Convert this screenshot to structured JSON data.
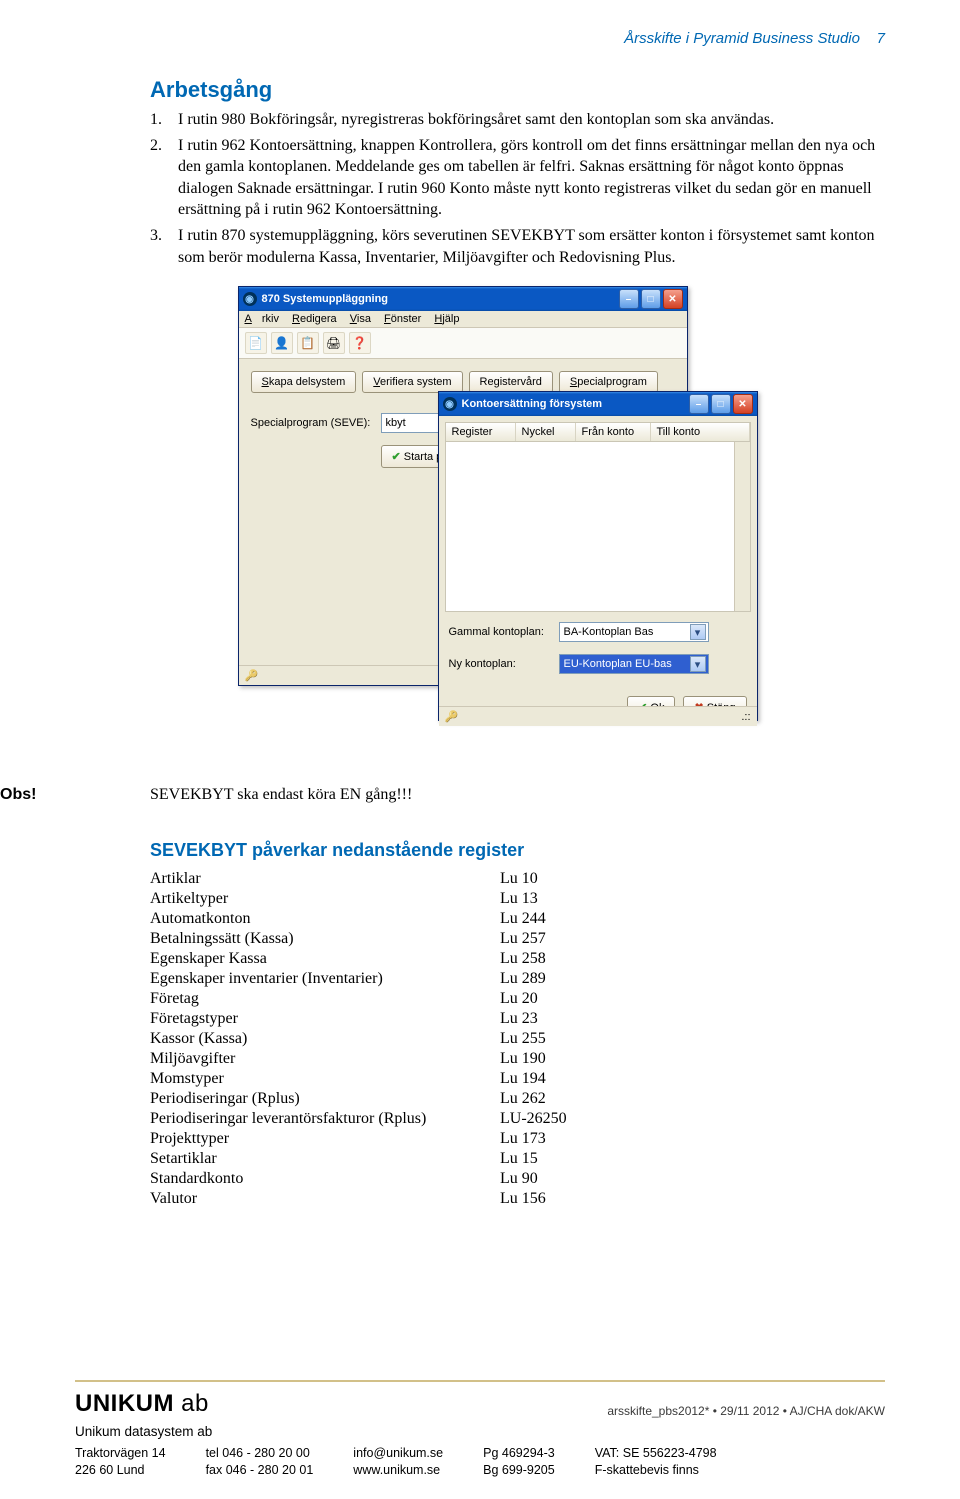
{
  "header": {
    "running_title": "Årsskifte i Pyramid Business Studio",
    "page_no": "7"
  },
  "section": {
    "heading": "Arbetsgång"
  },
  "steps": [
    {
      "n": "1.",
      "text": "I rutin 980 Bokföringsår, nyregistreras bokföringsåret samt den kontoplan som ska användas."
    },
    {
      "n": "2.",
      "text": "I rutin 962 Kontoersättning, knappen Kontrollera, görs kontroll om det finns ersättningar mellan den nya och den gamla kontoplanen. Meddelande ges om tabellen är felfri. Saknas ersättning för något konto öppnas dialogen Saknade ersättningar. I rutin 960 Konto måste nytt konto registreras vilket du sedan gör en manuell ersättning på i rutin 962 Kontoersättning."
    },
    {
      "n": "3.",
      "text": "I rutin 870 systemuppläggning, körs severutinen SEVEKBYT som ersätter konton i försystemet samt konton som berör modulerna Kassa, Inventarier, Miljöavgifter och Redovisning Plus."
    }
  ],
  "win870": {
    "title": "870 Systemuppläggning",
    "menu": {
      "arkiv": "Arkiv",
      "redigera": "Redigera",
      "visa": "Visa",
      "fonster": "Fönster",
      "hjalp": "Hjälp"
    },
    "buttons": {
      "skapa": "Skapa delsystem",
      "verifiera": "Verifiera system",
      "registervard": "Registervård",
      "specialprogram": "Specialprogram"
    },
    "field_label": "Specialprogram (SEVE):",
    "field_value": "kbyt",
    "start": "Starta program"
  },
  "dlg": {
    "title": "Kontoersättning försystem",
    "cols": {
      "register": "Register",
      "nyckel": "Nyckel",
      "fran": "Från konto",
      "till": "Till konto"
    },
    "gammal_label": "Gammal kontoplan:",
    "gammal_value": "BA-Kontoplan Bas",
    "ny_label": "Ny kontoplan:",
    "ny_value": "EU-Kontoplan EU-bas",
    "ok": "Ok",
    "stang": "Stäng"
  },
  "obs": {
    "label": "Obs!",
    "text": "SEVEKBYT ska endast köra EN gång!!!"
  },
  "subheading": "SEVEKBYT påverkar nedanstående register",
  "registers": [
    {
      "name": "Artiklar",
      "code": "Lu 10"
    },
    {
      "name": "Artikeltyper",
      "code": "Lu 13"
    },
    {
      "name": "Automatkonton",
      "code": "Lu 244"
    },
    {
      "name": "Betalningssätt (Kassa)",
      "code": "Lu 257"
    },
    {
      "name": "Egenskaper Kassa",
      "code": "Lu 258"
    },
    {
      "name": "Egenskaper inventarier (Inventarier)",
      "code": "Lu 289"
    },
    {
      "name": "Företag",
      "code": "Lu 20"
    },
    {
      "name": "Företagstyper",
      "code": "Lu 23"
    },
    {
      "name": "Kassor (Kassa)",
      "code": "Lu 255"
    },
    {
      "name": "Miljöavgifter",
      "code": "Lu 190"
    },
    {
      "name": "Momstyper",
      "code": "Lu 194"
    },
    {
      "name": "Periodiseringar (Rplus)",
      "code": "Lu 262"
    },
    {
      "name": "Periodiseringar leverantörsfakturor (Rplus)",
      "code": "LU-26250"
    },
    {
      "name": "Projekttyper",
      "code": "Lu 173"
    },
    {
      "name": "Setartiklar",
      "code": "Lu 15"
    },
    {
      "name": "Standardkonto",
      "code": "Lu 90"
    },
    {
      "name": "Valutor",
      "code": "Lu 156"
    }
  ],
  "footer": {
    "brand": "UNIKUM",
    "brand_suffix": "ab",
    "meta": "arsskifte_pbs2012*  •  29/11 2012  •  AJ/CHA  dok/AKW",
    "sub": "Unikum datasystem ab",
    "col1": "Traktorvägen 14\n226 60  Lund",
    "col2": "tel  046 - 280 20 00\nfax 046 - 280 20 01",
    "col3": "info@unikum.se\nwww.unikum.se",
    "col4": "Pg  469294-3\nBg  699-9205",
    "col5": "VAT: SE 556223-4798\nF-skattebevis finns"
  }
}
